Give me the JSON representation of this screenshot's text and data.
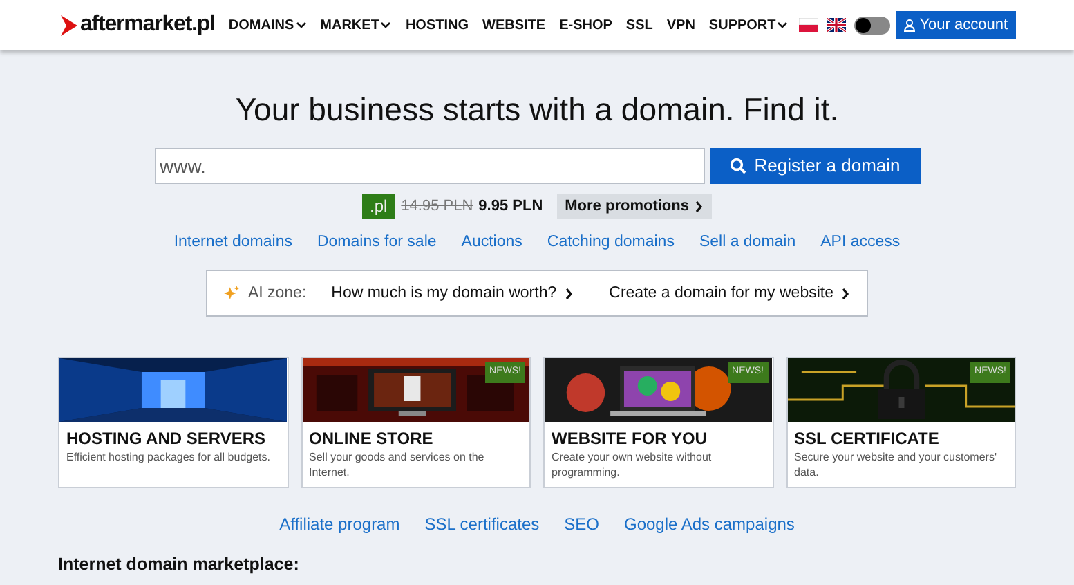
{
  "header": {
    "logo": "aftermarket.pl",
    "nav": [
      {
        "label": "DOMAINS",
        "dropdown": true
      },
      {
        "label": "MARKET",
        "dropdown": true
      },
      {
        "label": "HOSTING",
        "dropdown": false
      },
      {
        "label": "WEBSITE",
        "dropdown": false
      },
      {
        "label": "E-SHOP",
        "dropdown": false
      },
      {
        "label": "SSL",
        "dropdown": false
      },
      {
        "label": "VPN",
        "dropdown": false
      },
      {
        "label": "SUPPORT",
        "dropdown": true
      }
    ],
    "languages": [
      {
        "kind": "pl"
      },
      {
        "kind": "uk"
      }
    ],
    "theme_toggle": {
      "on": false
    },
    "account_button": "Your account"
  },
  "hero": {
    "title": "Your business starts with a domain. Find it.",
    "search": {
      "value": "www.",
      "button": "Register a domain"
    },
    "promo": {
      "tld": ".pl",
      "old_price": "14.95 PLN",
      "new_price": "9.95 PLN",
      "more": "More promotions"
    },
    "links": [
      "Internet domains",
      "Domains for sale",
      "Auctions",
      "Catching domains",
      "Sell a domain",
      "API access"
    ],
    "ai_zone": {
      "label": "AI zone:",
      "links": [
        "How much is my domain worth?",
        "Create a domain for my website"
      ]
    }
  },
  "cards": [
    {
      "title": "HOSTING AND SERVERS",
      "text": "Efficient hosting packages for all budgets.",
      "news": false,
      "kind": "servers"
    },
    {
      "title": "ONLINE STORE",
      "text": "Sell your goods and services on the Internet.",
      "news": true,
      "badge": "NEWS!",
      "kind": "store"
    },
    {
      "title": "WEBSITE FOR YOU",
      "text": "Create your own website without programming.",
      "news": true,
      "badge": "NEWS!",
      "kind": "web"
    },
    {
      "title": "SSL CERTIFICATE",
      "text": "Secure your website and your customers' data.",
      "news": true,
      "badge": "NEWS!",
      "kind": "ssl"
    }
  ],
  "footer_links": [
    "Affiliate program",
    "SSL certificates",
    "SEO",
    "Google Ads campaigns"
  ],
  "section_title": "Internet domain marketplace:"
}
